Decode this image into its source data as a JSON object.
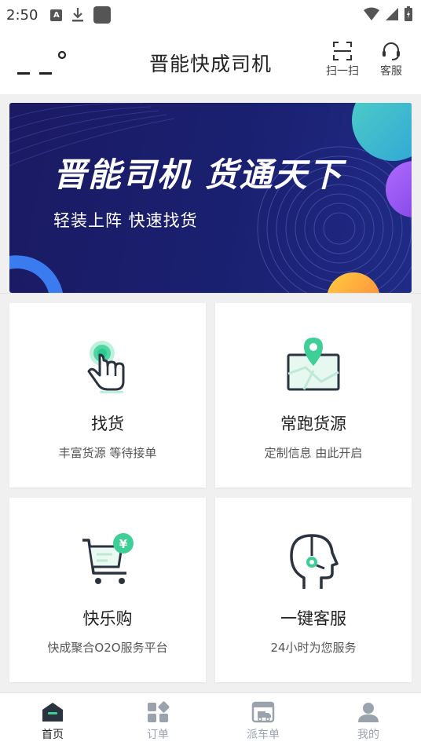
{
  "status_bar": {
    "time": "2:50",
    "notification_letter": "A"
  },
  "header": {
    "title": "晋能快成司机",
    "scan_label": "扫一扫",
    "service_label": "客服"
  },
  "banner": {
    "title": "晋能司机 货通天下",
    "subtitle": "轻装上阵  快速找货"
  },
  "cards": [
    {
      "title": "找货",
      "desc": "丰富货源 等待接单",
      "icon": "tap-hand-icon"
    },
    {
      "title": "常跑货源",
      "desc": "定制信息 由此开启",
      "icon": "map-pin-icon"
    },
    {
      "title": "快乐购",
      "desc": "快成聚合O2O服务平台",
      "icon": "shopping-cart-icon"
    },
    {
      "title": "一键客服",
      "desc": "24小时为您服务",
      "icon": "head-service-icon"
    }
  ],
  "bottom_nav": [
    {
      "label": "首页",
      "icon": "home-icon",
      "active": true
    },
    {
      "label": "订单",
      "icon": "orders-icon",
      "active": false
    },
    {
      "label": "派车单",
      "icon": "dispatch-icon",
      "active": false
    },
    {
      "label": "我的",
      "icon": "profile-icon",
      "active": false
    }
  ],
  "colors": {
    "accent": "#2fc98f",
    "banner_bg": "#1b1a63",
    "icon_dark": "#2b3340",
    "nav_inactive": "#9aa3ad"
  }
}
